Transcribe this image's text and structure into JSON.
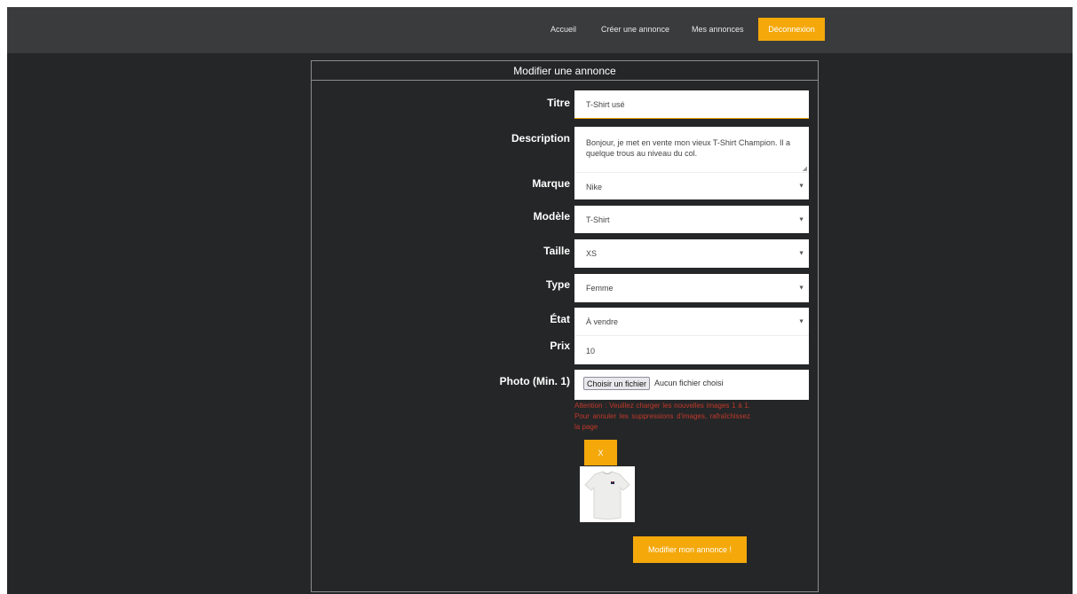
{
  "nav": {
    "items": [
      "Accueil",
      "Créer une annonce",
      "Mes annonces"
    ],
    "logout_label": "Déconnexion"
  },
  "form": {
    "title": "Modifier une annonce",
    "titre": {
      "label": "Titre",
      "value": "T-Shirt usé"
    },
    "description": {
      "label": "Description",
      "value": "Bonjour, je met en vente mon vieux T-Shirt Champion. Il a quelque trous au niveau du col."
    },
    "marque": {
      "label": "Marque",
      "value": "Nike"
    },
    "modele": {
      "label": "Modèle",
      "value": "T-Shirt"
    },
    "taille": {
      "label": "Taille",
      "value": "XS"
    },
    "type": {
      "label": "Type",
      "value": "Femme"
    },
    "etat": {
      "label": "État",
      "value": "À vendre"
    },
    "prix": {
      "label": "Prix",
      "value": "10"
    },
    "photo": {
      "label": "Photo (Min. 1)",
      "button_label": "Choisir un fichier",
      "status": "Aucun fichier choisi"
    },
    "warning": "Attention : Veuillez charger les nouvelles images 1 à 1. Pour annuler les suppressions d'images, rafraîchissez la page",
    "remove_image_label": "X",
    "submit_label": "Modifier mon annonce !"
  },
  "colors": {
    "background": "#252627",
    "navbar": "#3a3b3c",
    "accent": "#f4a80a",
    "warning": "#c0392b"
  }
}
